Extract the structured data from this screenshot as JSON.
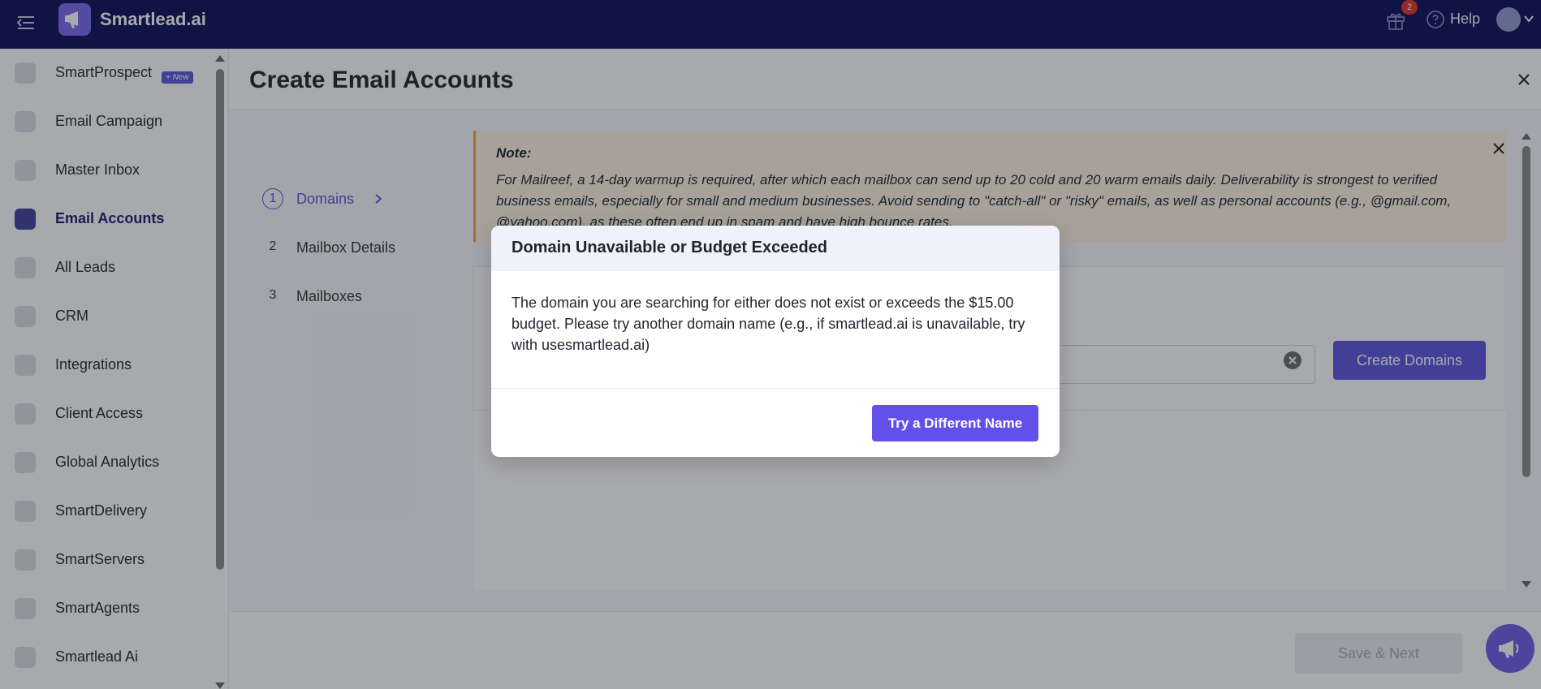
{
  "topbar": {
    "brand": "Smartlead.ai",
    "gift_badge_count": "2",
    "help_label": "Help",
    "icons": [
      "menu-toggle-icon",
      "logo-icon",
      "gift-icon",
      "help-circle-icon",
      "avatar",
      "chevron-down-icon"
    ]
  },
  "sidebar": {
    "items": [
      {
        "label": "SmartProspect",
        "icon": "people-icon",
        "badge": "+ New"
      },
      {
        "label": "Email Campaign",
        "icon": "megaphone-icon"
      },
      {
        "label": "Master Inbox",
        "icon": "inbox-icon"
      },
      {
        "label": "Email Accounts",
        "icon": "mail-icon",
        "active": true
      },
      {
        "label": "All Leads",
        "icon": "leads-icon"
      },
      {
        "label": "CRM",
        "icon": "dollar-icon"
      },
      {
        "label": "Integrations",
        "icon": "puzzle-icon"
      },
      {
        "label": "Client Access",
        "icon": "lightning-icon"
      },
      {
        "label": "Global Analytics",
        "icon": "bar-chart-icon"
      },
      {
        "label": "SmartDelivery",
        "icon": "layers-icon"
      },
      {
        "label": "SmartServers",
        "icon": "server-icon"
      },
      {
        "label": "SmartAgents",
        "icon": "agent-icon"
      },
      {
        "label": "Smartlead Ai",
        "icon": "ai-icon"
      }
    ]
  },
  "main": {
    "title": "Create Email Accounts",
    "steps": [
      {
        "num": "1",
        "label": "Domains",
        "active": true
      },
      {
        "num": "2",
        "label": "Mailbox Details"
      },
      {
        "num": "3",
        "label": "Mailboxes"
      }
    ],
    "note": {
      "title": "Note:",
      "text": "For Mailreef, a 14-day warmup is required, after which each mailbox can send up to 20 cold and 20 warm emails daily. Deliverability is strongest to verified business emails, especially for small and medium businesses. Avoid sending to \"catch-all\" or \"risky\" emails, as well as personal accounts (e.g., @gmail.com, @yahoo.com), as these often end up in spam and have high bounce rates."
    },
    "create_domains_label": "Create Domains",
    "save_next_label": "Save & Next"
  },
  "modal": {
    "title": "Domain Unavailable or Budget Exceeded",
    "body": "The domain you are searching for either does not exist or exceeds the $15.00 budget. Please try another domain name (e.g., if smartlead.ai is unavailable, try with usesmartlead.ai)",
    "primary_label": "Try a Different Name"
  },
  "colors": {
    "topbar_bg": "#0d0d5a",
    "accent": "#5a55dc",
    "button_primary": "#6250ea",
    "note_bg": "#fdf3e2",
    "note_border": "#f0a640",
    "badge_red": "#e0322b"
  }
}
